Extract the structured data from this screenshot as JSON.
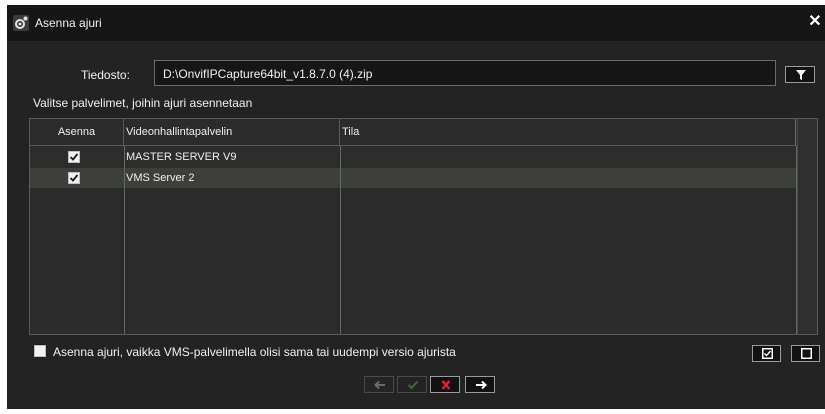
{
  "window": {
    "title": "Asenna ajuri"
  },
  "file": {
    "label": "Tiedosto:",
    "path": "D:\\OnvifIPCapture64bit_v1.8.7.0 (4).zip"
  },
  "instruction": "Valitse palvelimet, joihin ajuri asennetaan",
  "grid": {
    "columns": [
      "Asenna",
      "Videonhallintapalvelin",
      "Tila"
    ],
    "rows": [
      {
        "install": true,
        "server": "MASTER SERVER V9",
        "status": ""
      },
      {
        "install": true,
        "server": "VMS Server 2",
        "status": ""
      }
    ]
  },
  "force_install": {
    "checked": false,
    "label": "Asenna ajuri, vaikka VMS-palvelimella olisi sama tai uudempi versio ajurista"
  },
  "icons": {
    "app": "settings-gear-icon",
    "close": "close-icon",
    "browse": "funnel-icon",
    "select_all": "checked-box-icon",
    "select_none": "empty-box-icon",
    "back": "arrow-left-icon",
    "ok": "checkmark-icon",
    "cancel": "x-icon",
    "next": "arrow-right-icon"
  },
  "colors": {
    "background": "#232323",
    "titlebar": "#161616",
    "selected_row": "#3d3f3b",
    "cancel_red": "#e8202a"
  }
}
